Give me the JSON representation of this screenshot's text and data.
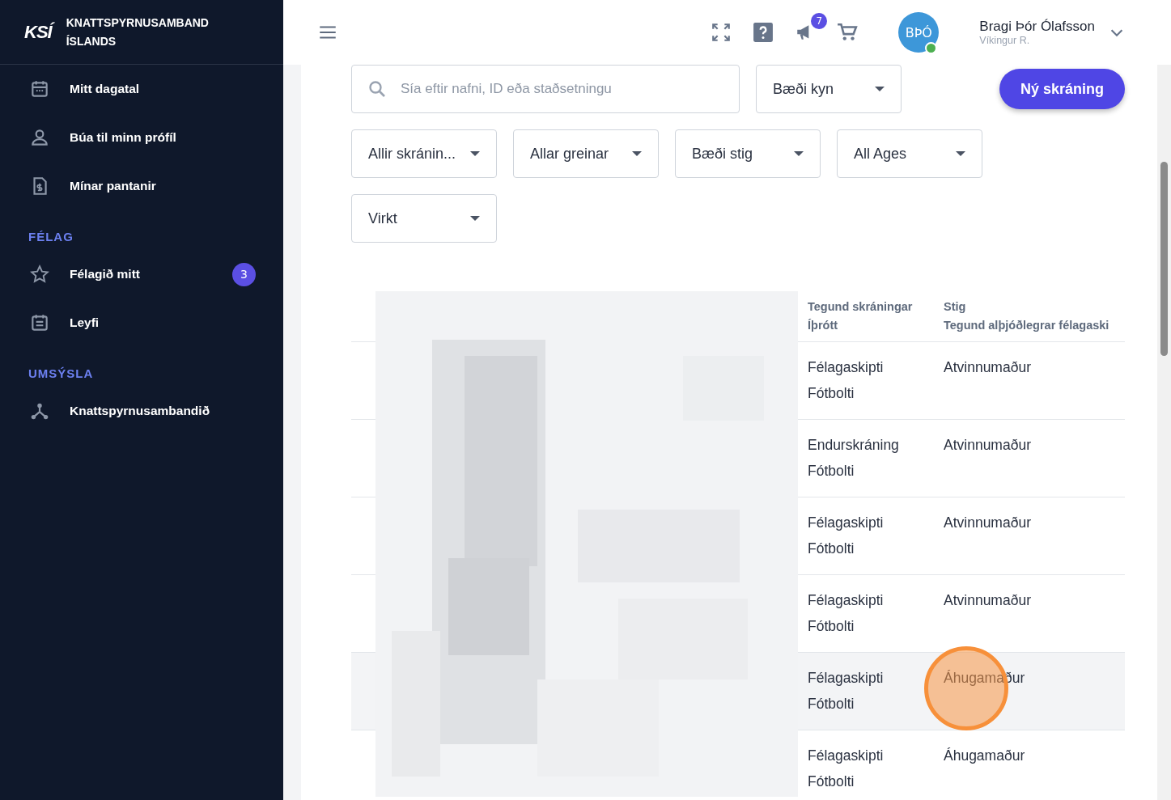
{
  "brand": {
    "logo": "KSÍ",
    "name_line_1": "KNATTSPYRNUSAMBAND",
    "name_line_2": "ÍSLANDS"
  },
  "sidebar": {
    "items": [
      {
        "label": "Mitt dagatal"
      },
      {
        "label": "Búa til minn prófíl"
      },
      {
        "label": "Mínar pantanir"
      }
    ],
    "sections": [
      {
        "title": "FÉLAG",
        "items": [
          {
            "label": "Félagið mitt",
            "badge": "3"
          },
          {
            "label": "Leyfi"
          }
        ]
      },
      {
        "title": "UMSÝSLA",
        "items": [
          {
            "label": "Knattspyrnusambandið"
          }
        ]
      }
    ]
  },
  "header": {
    "notifications": "7",
    "user": {
      "initials": "BÞÓ",
      "online": true,
      "name": "Bragi Þór Ólafsson",
      "club": "Víkingur R."
    }
  },
  "filters": {
    "search": {
      "placeholder": "Sía eftir nafni, ID eða staðsetningu"
    },
    "gender": "Bæði kyn",
    "new_button": "Ný skráning",
    "dropdowns": [
      "Allir skránin...",
      "Allar greinar",
      "Bæði stig",
      "All Ages",
      "Virkt"
    ]
  },
  "table": {
    "columns": [
      {
        "line_1": "Tegund skráningar",
        "line_2": "Íþrótt"
      },
      {
        "line_1": "Stig",
        "line_2": "Tegund alþjóðlegrar félagaski"
      }
    ],
    "rows": [
      {
        "type": "Félagaskipti",
        "sport": "Fótbolti",
        "level": "Atvinnumaður",
        "selected": false
      },
      {
        "type": "Endurskráning",
        "sport": "Fótbolti",
        "level": "Atvinnumaður",
        "selected": false
      },
      {
        "type": "Félagaskipti",
        "sport": "Fótbolti",
        "level": "Atvinnumaður",
        "selected": false
      },
      {
        "type": "Félagaskipti",
        "sport": "Fótbolti",
        "level": "Atvinnumaður",
        "selected": false
      },
      {
        "type": "Félagaskipti",
        "sport": "Fótbolti",
        "level": "Áhugamaður",
        "selected": true
      },
      {
        "type": "Félagaskipti",
        "sport": "Fótbolti",
        "level": "Áhugamaður",
        "selected": false
      }
    ]
  }
}
